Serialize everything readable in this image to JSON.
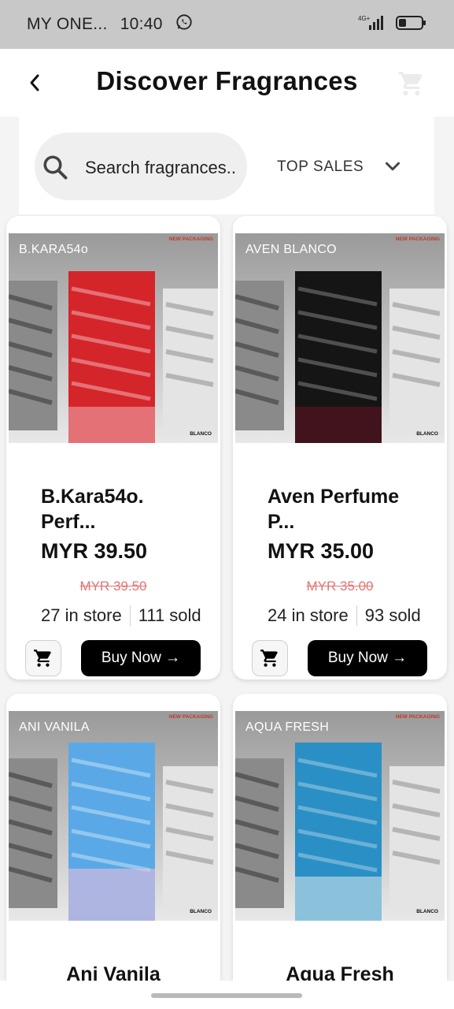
{
  "status_bar": {
    "carrier": "MY ONE...",
    "time": "10:40",
    "network": "4G+"
  },
  "header": {
    "title": "Discover Fragrances"
  },
  "filters": {
    "search_placeholder": "Search fragrances..",
    "sort_label": "TOP SALES"
  },
  "products": [
    {
      "image_label": "B.KARA54o",
      "image_tag": "NEW PACKAGING",
      "image_logo": "BLANCO",
      "bottle_color": "#d4252b",
      "name": "B.Kara54o. Perf...",
      "price": "MYR 39.50",
      "old_price": "MYR 39.50",
      "in_store": "27 in store",
      "sold": "111 sold",
      "buy_label": "Buy Now →"
    },
    {
      "image_label": "AVEN BLANCO",
      "image_tag": "NEW PACKAGING",
      "image_logo": "BLANCO",
      "bottle_color": "#151515",
      "name": "Aven  Perfume P...",
      "price": "MYR 35.00",
      "old_price": "MYR 35.00",
      "in_store": "24 in store",
      "sold": "93 sold",
      "buy_label": "Buy Now →"
    },
    {
      "image_label": "ANI VANILA",
      "image_tag": "NEW PACKAGING",
      "image_logo": "BLANCO",
      "bottle_color": "#5aa9e6",
      "name": "Ani Vanila"
    },
    {
      "image_label": "AQUA FRESH",
      "image_tag": "NEW PACKAGING",
      "image_logo": "BLANCO",
      "bottle_color": "#2a8fc4",
      "name": "Aqua Fresh"
    }
  ]
}
